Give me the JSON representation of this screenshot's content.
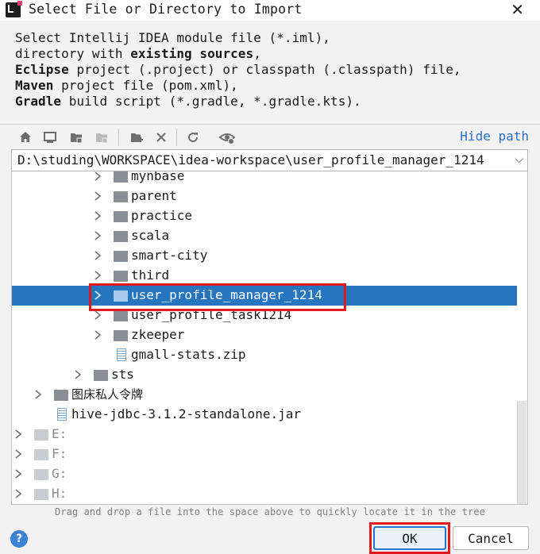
{
  "window": {
    "title": "Select File or Directory to Import",
    "close_glyph": "✕"
  },
  "description": {
    "line1": "Select Intellij IDEA module file (*.iml),",
    "line2_pre": "directory with ",
    "line2_bold": "existing sources",
    "line2_post": ",",
    "line3_bold": "Eclipse",
    "line3_rest": " project (.project) or classpath (.classpath) file,",
    "line4_bold": "Maven",
    "line4_rest": " project file (pom.xml),",
    "line5_bold": "Gradle",
    "line5_rest": " build script (*.gradle, *.gradle.kts)."
  },
  "toolbar": {
    "icons": [
      "home-icon",
      "desktop-icon",
      "project-folder-icon",
      "module-folder-icon",
      "new-folder-icon",
      "delete-icon",
      "refresh-icon",
      "show-hidden-icon"
    ],
    "hide_path_label": "Hide path"
  },
  "path": {
    "value": "D:\\studing\\WORKSPACE\\idea-workspace\\user_profile_manager_1214",
    "dropdown_glyph": "⌵"
  },
  "tree": {
    "items": [
      {
        "label": "mynbase"
      },
      {
        "label": "parent"
      },
      {
        "label": "practice"
      },
      {
        "label": "scala"
      },
      {
        "label": "smart-city"
      },
      {
        "label": "third"
      },
      {
        "label": "user_profile_manager_1214"
      },
      {
        "label": "user_profile_task1214"
      },
      {
        "label": "zkeeper"
      },
      {
        "label": "gmall-stats.zip"
      },
      {
        "label": "sts"
      },
      {
        "label": "图床私人令牌"
      },
      {
        "label": "hive-jdbc-3.1.2-standalone.jar"
      },
      {
        "label": "E:"
      },
      {
        "label": "F:"
      },
      {
        "label": "G:"
      },
      {
        "label": "H:"
      }
    ],
    "selected_item": "user_profile_manager_1214"
  },
  "hint": "Drag and drop a file into the space above to quickly locate it in the tree",
  "buttons": {
    "help_glyph": "?",
    "ok": "OK",
    "cancel": "Cancel"
  },
  "colors": {
    "selection": "#2675bf",
    "link": "#2b6fc7",
    "annotation": "#e0191f"
  }
}
